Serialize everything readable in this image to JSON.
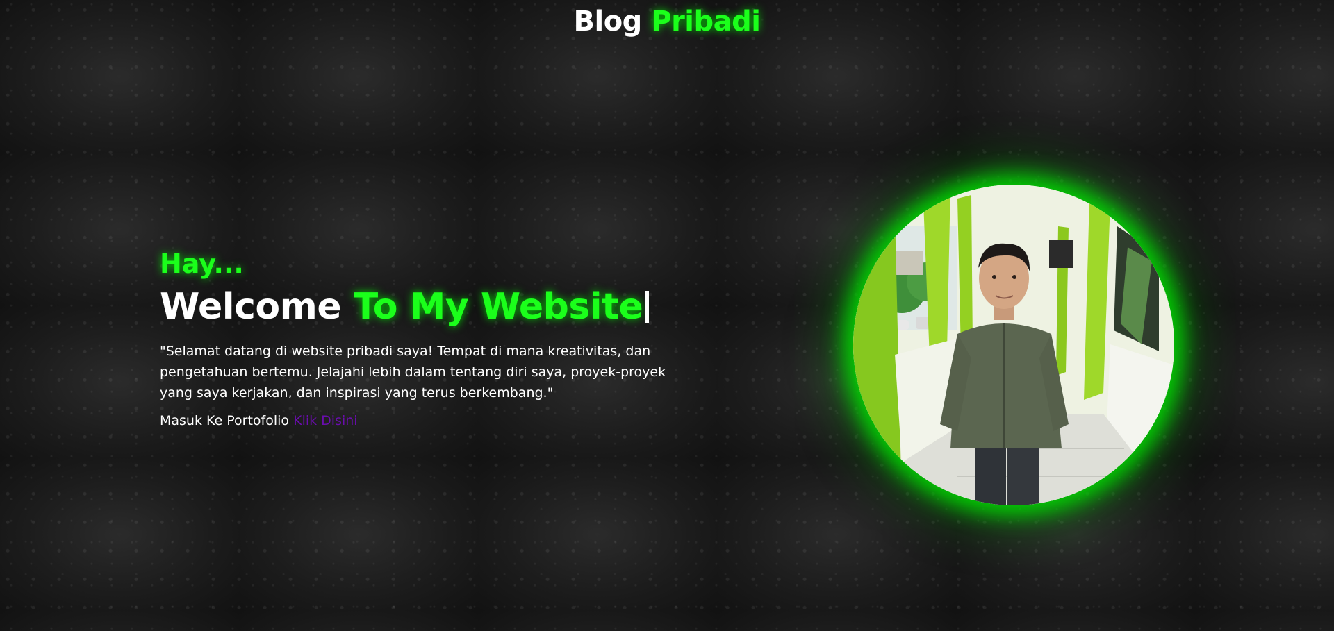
{
  "header": {
    "title_part1": "Blog",
    "title_part2": "Pribadi"
  },
  "hero": {
    "greeting": "Hay...",
    "headline_part1": "Welcome",
    "headline_part2": "To My Website",
    "quote": "\"Selamat datang di website pribadi saya! Tempat di mana kreativitas, dan pengetahuan bertemu. Jelajahi lebih dalam tentang diri saya, proyek-proyek yang saya kerjakan, dan inspirasi yang terus berkembang.\"",
    "portfolio_prefix": "Masuk Ke Portofolio",
    "portfolio_link": "Klik Disini"
  },
  "profile": {
    "image_subject": "man-in-green-shirt-in-school-corridor",
    "glow_color": "#00e600"
  },
  "colors": {
    "accent": "#1bff1b",
    "link": "#6a0dad",
    "background": "#161616"
  }
}
